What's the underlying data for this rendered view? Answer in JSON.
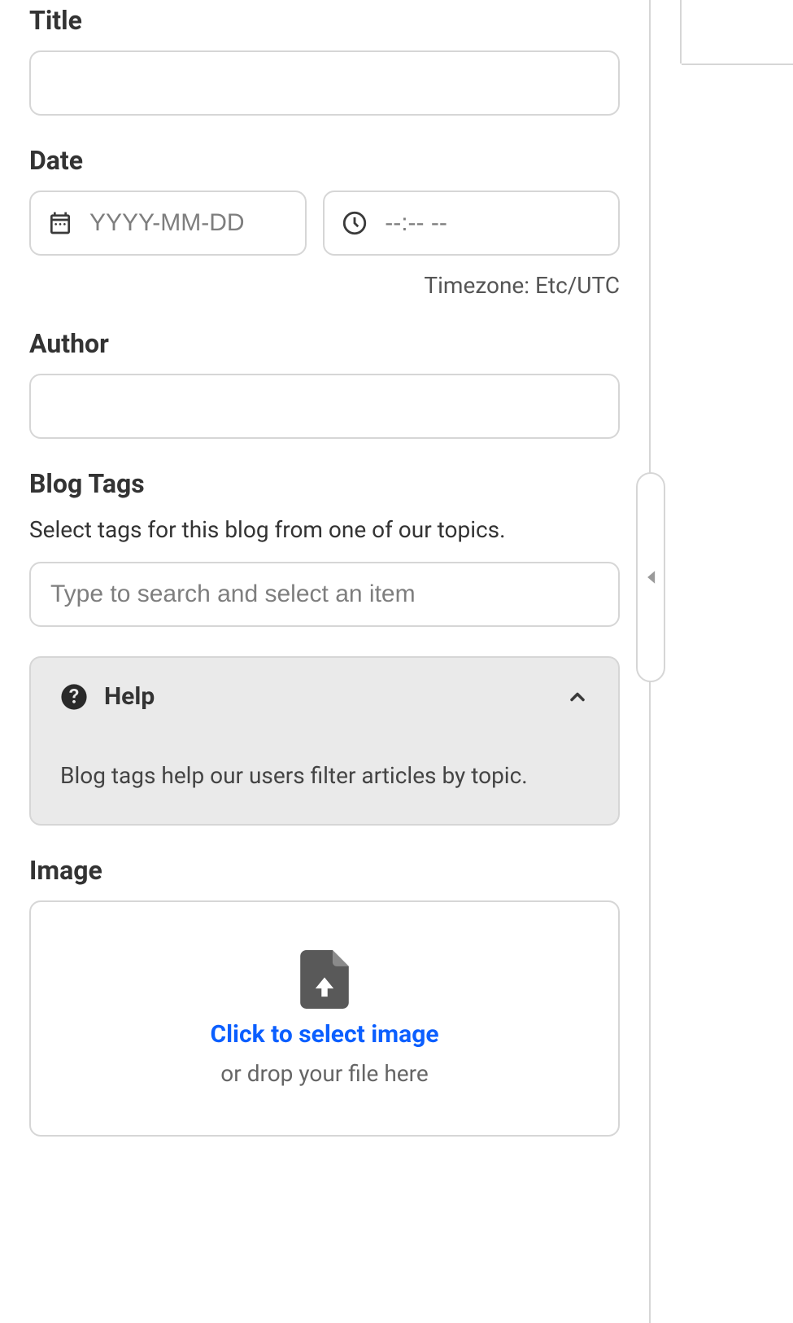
{
  "form": {
    "title": {
      "label": "Title",
      "value": ""
    },
    "date": {
      "label": "Date",
      "date_placeholder": "YYYY-MM-DD",
      "date_value": "",
      "time_placeholder": "--:-- --",
      "time_value": "",
      "timezone_label": "Timezone: Etc/UTC"
    },
    "author": {
      "label": "Author",
      "value": ""
    },
    "tags": {
      "label": "Blog Tags",
      "description": "Select tags for this blog from one of our topics.",
      "search_placeholder": "Type to search and select an item",
      "search_value": ""
    },
    "help": {
      "title": "Help",
      "body": "Blog tags help our users filter articles by topic."
    },
    "image": {
      "label": "Image",
      "cta": "Click to select image",
      "sub": "or drop your file here"
    }
  }
}
